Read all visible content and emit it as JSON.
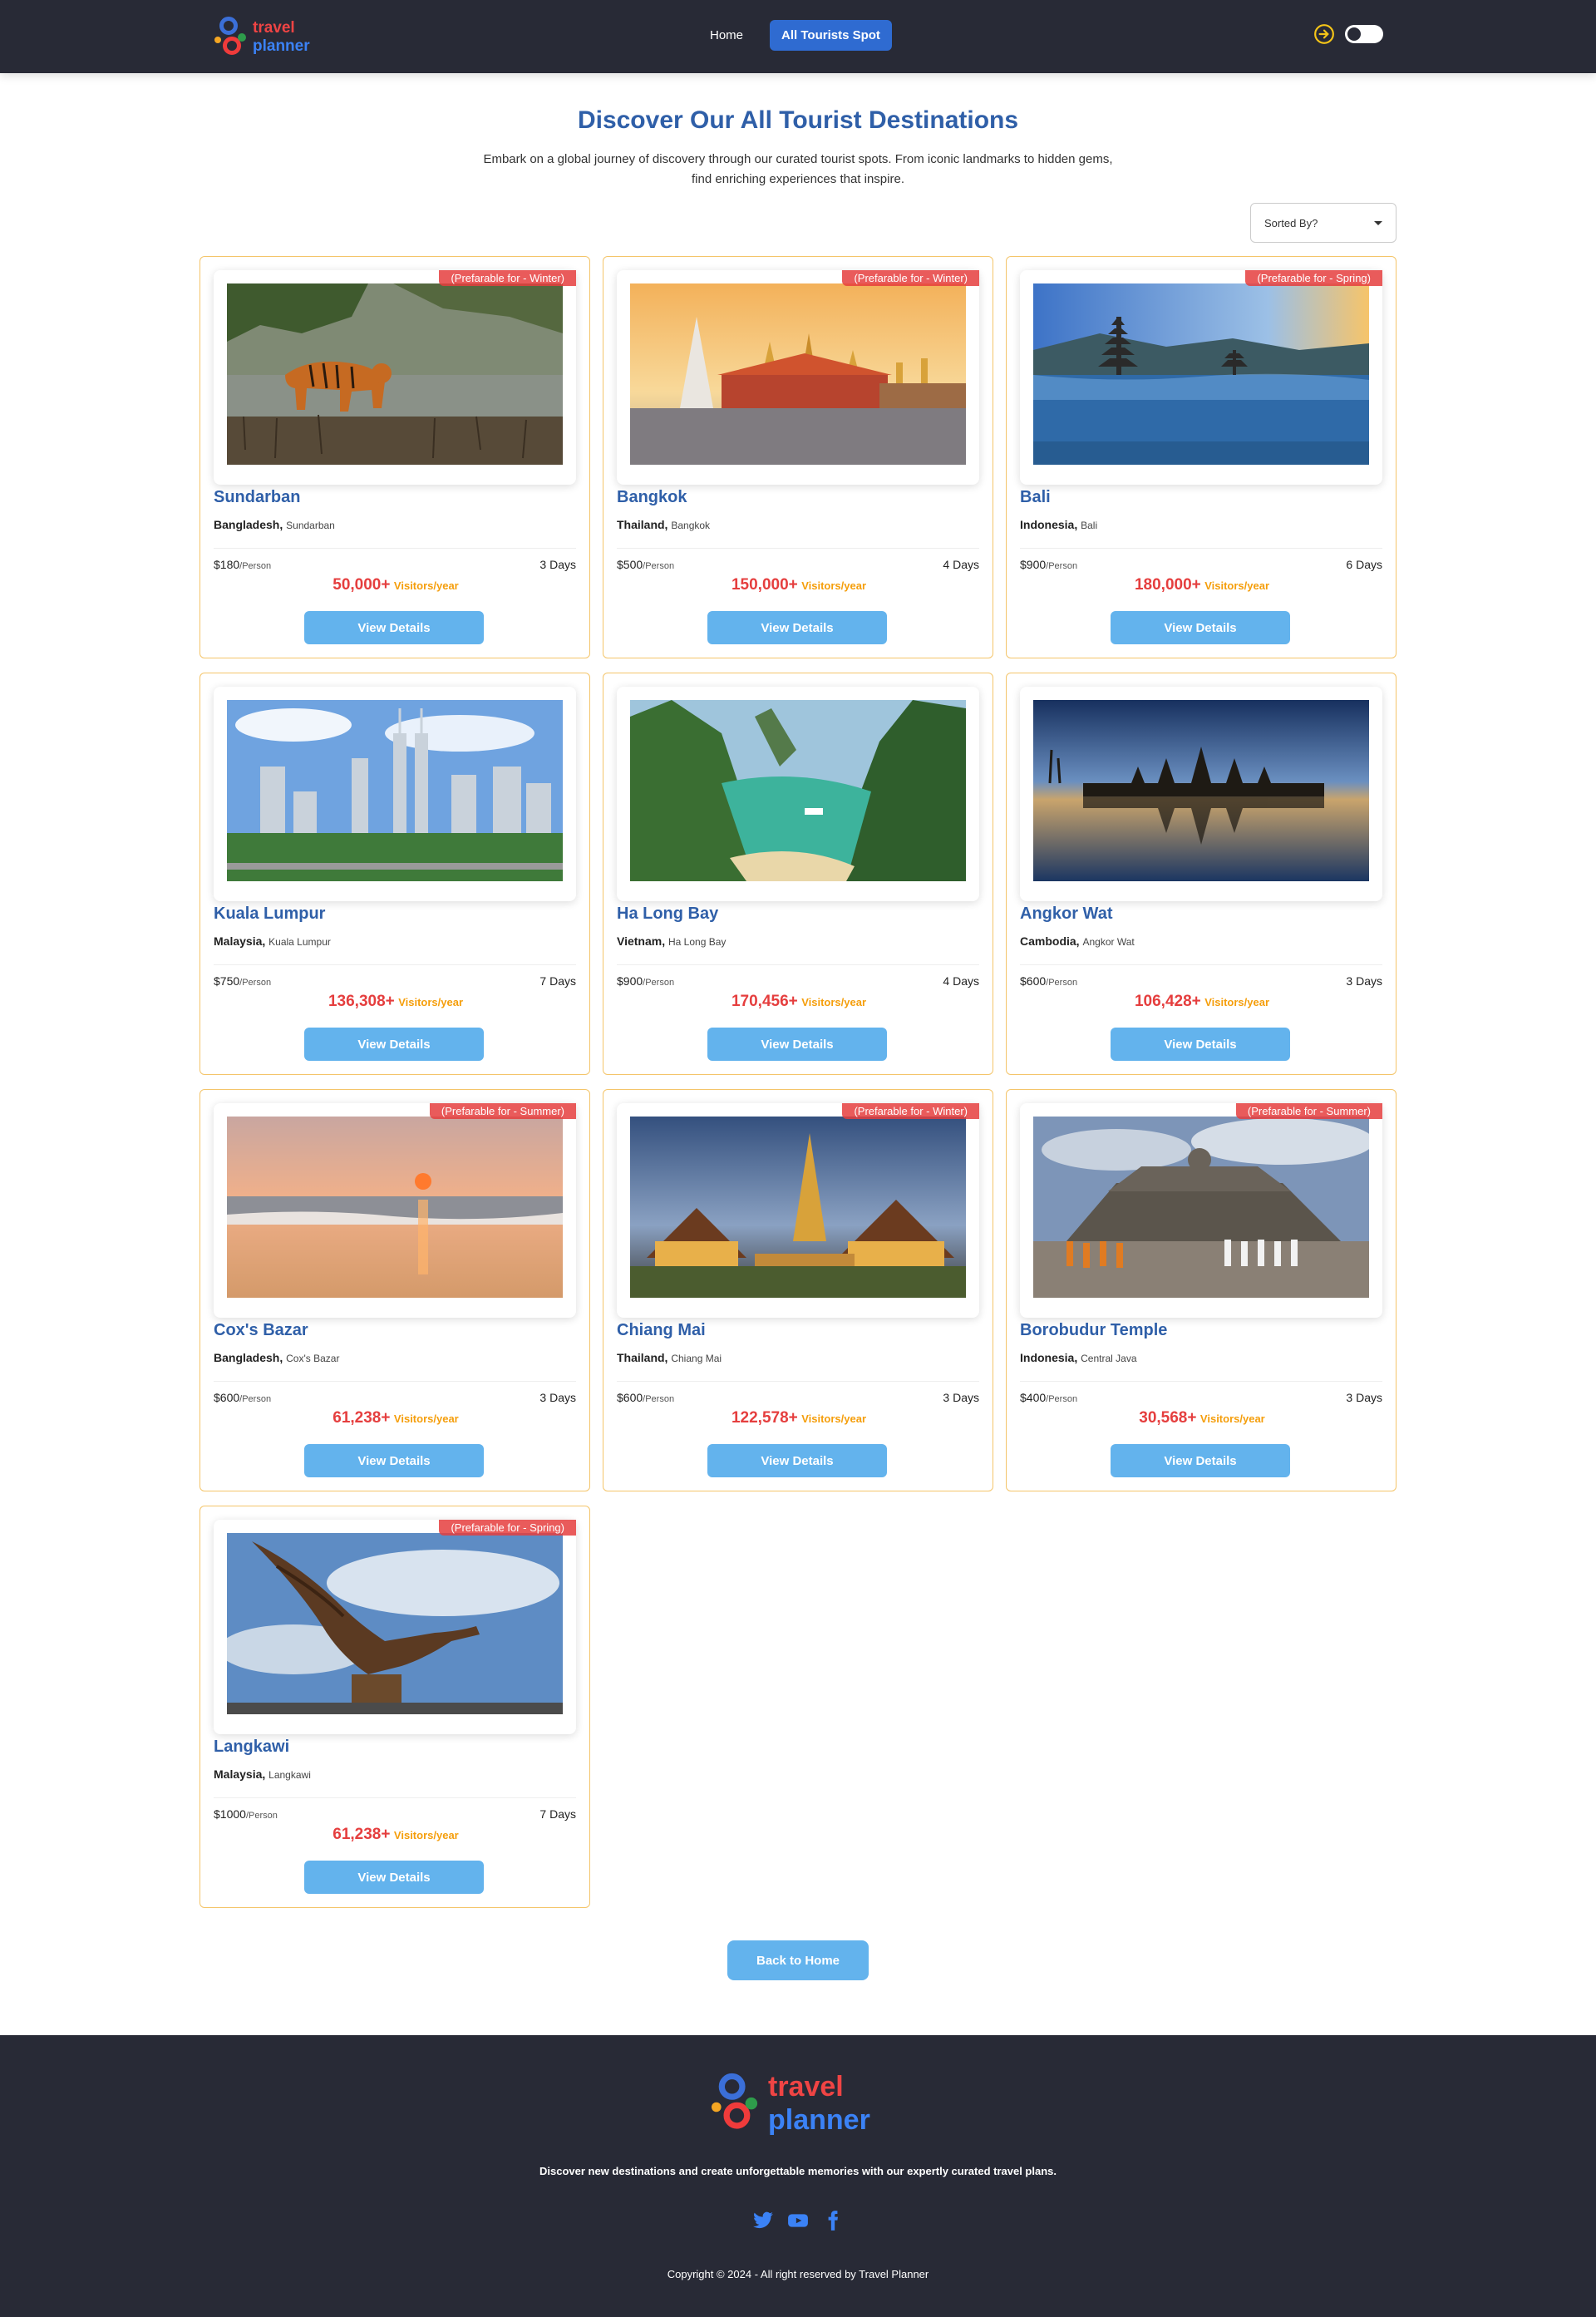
{
  "nav": {
    "logo_line1": "travel",
    "logo_line2": "planner",
    "links": [
      {
        "label": "Home"
      },
      {
        "label": "All Tourists Spot"
      }
    ]
  },
  "header": {
    "title": "Discover Our All Tourist Destinations",
    "subtitle": "Embark on a global journey of discovery through our curated tourist spots. From iconic landmarks to hidden gems, find enriching experiences that inspire.",
    "sort_label": "Sorted By?"
  },
  "cards": [
    {
      "badge": "(Prefarable for - Winter)",
      "title": "Sundarban",
      "country": "Bangladesh,",
      "area": "Sundarban",
      "price": "$180",
      "per": "/Person",
      "days": "3 Days",
      "visitors": "50,000+",
      "visitors_label": "Visitors/year",
      "button": "View Details",
      "image": "tiger-river-icon"
    },
    {
      "badge": "(Prefarable for - Winter)",
      "title": "Bangkok",
      "country": "Thailand,",
      "area": "Bangkok",
      "price": "$500",
      "per": "/Person",
      "days": "4 Days",
      "visitors": "150,000+",
      "visitors_label": "Visitors/year",
      "button": "View Details",
      "image": "temple-icon"
    },
    {
      "badge": "(Prefarable for - Spring)",
      "title": "Bali",
      "country": "Indonesia,",
      "area": "Bali",
      "price": "$900",
      "per": "/Person",
      "days": "6 Days",
      "visitors": "180,000+",
      "visitors_label": "Visitors/year",
      "button": "View Details",
      "image": "lake-temple-icon"
    },
    {
      "badge": "",
      "title": "Kuala Lumpur",
      "country": "Malaysia,",
      "area": "Kuala Lumpur",
      "price": "$750",
      "per": "/Person",
      "days": "7 Days",
      "visitors": "136,308+",
      "visitors_label": "Visitors/year",
      "button": "View Details",
      "image": "skyline-icon"
    },
    {
      "badge": "",
      "title": "Ha Long Bay",
      "country": "Vietnam,",
      "area": "Ha Long Bay",
      "price": "$900",
      "per": "/Person",
      "days": "4 Days",
      "visitors": "170,456+",
      "visitors_label": "Visitors/year",
      "button": "View Details",
      "image": "bay-icon"
    },
    {
      "badge": "",
      "title": "Angkor Wat",
      "country": "Cambodia,",
      "area": "Angkor Wat",
      "price": "$600",
      "per": "/Person",
      "days": "3 Days",
      "visitors": "106,428+",
      "visitors_label": "Visitors/year",
      "button": "View Details",
      "image": "angkor-reflection-icon"
    },
    {
      "badge": "(Prefarable for - Summer)",
      "title": "Cox's Bazar",
      "country": "Bangladesh,",
      "area": "Cox's Bazar",
      "price": "$600",
      "per": "/Person",
      "days": "3 Days",
      "visitors": "61,238+",
      "visitors_label": "Visitors/year",
      "button": "View Details",
      "image": "sunset-beach-icon"
    },
    {
      "badge": "(Prefarable for - Winter)",
      "title": "Chiang Mai",
      "country": "Thailand,",
      "area": "Chiang Mai",
      "price": "$600",
      "per": "/Person",
      "days": "3 Days",
      "visitors": "122,578+",
      "visitors_label": "Visitors/year",
      "button": "View Details",
      "image": "night-temple-icon"
    },
    {
      "badge": "(Prefarable for - Summer)",
      "title": "Borobudur Temple",
      "country": "Indonesia,",
      "area": "Central Java",
      "price": "$400",
      "per": "/Person",
      "days": "3 Days",
      "visitors": "30,568+",
      "visitors_label": "Visitors/year",
      "button": "View Details",
      "image": "stupa-monks-icon"
    },
    {
      "badge": "(Prefarable for - Spring)",
      "title": "Langkawi",
      "country": "Malaysia,",
      "area": "Langkawi",
      "price": "$1000",
      "per": "/Person",
      "days": "7 Days",
      "visitors": "61,238+",
      "visitors_label": "Visitors/year",
      "button": "View Details",
      "image": "eagle-statue-icon"
    }
  ],
  "back_button": "Back to Home",
  "footer": {
    "logo_line1": "travel",
    "logo_line2": "planner",
    "tagline": "Discover new destinations and create unforgettable memories with our expertly curated travel plans.",
    "socials": [
      "twitter-icon",
      "youtube-icon",
      "facebook-icon"
    ],
    "copyright": "Copyright © 2024 - All right reserved by Travel Planner"
  }
}
